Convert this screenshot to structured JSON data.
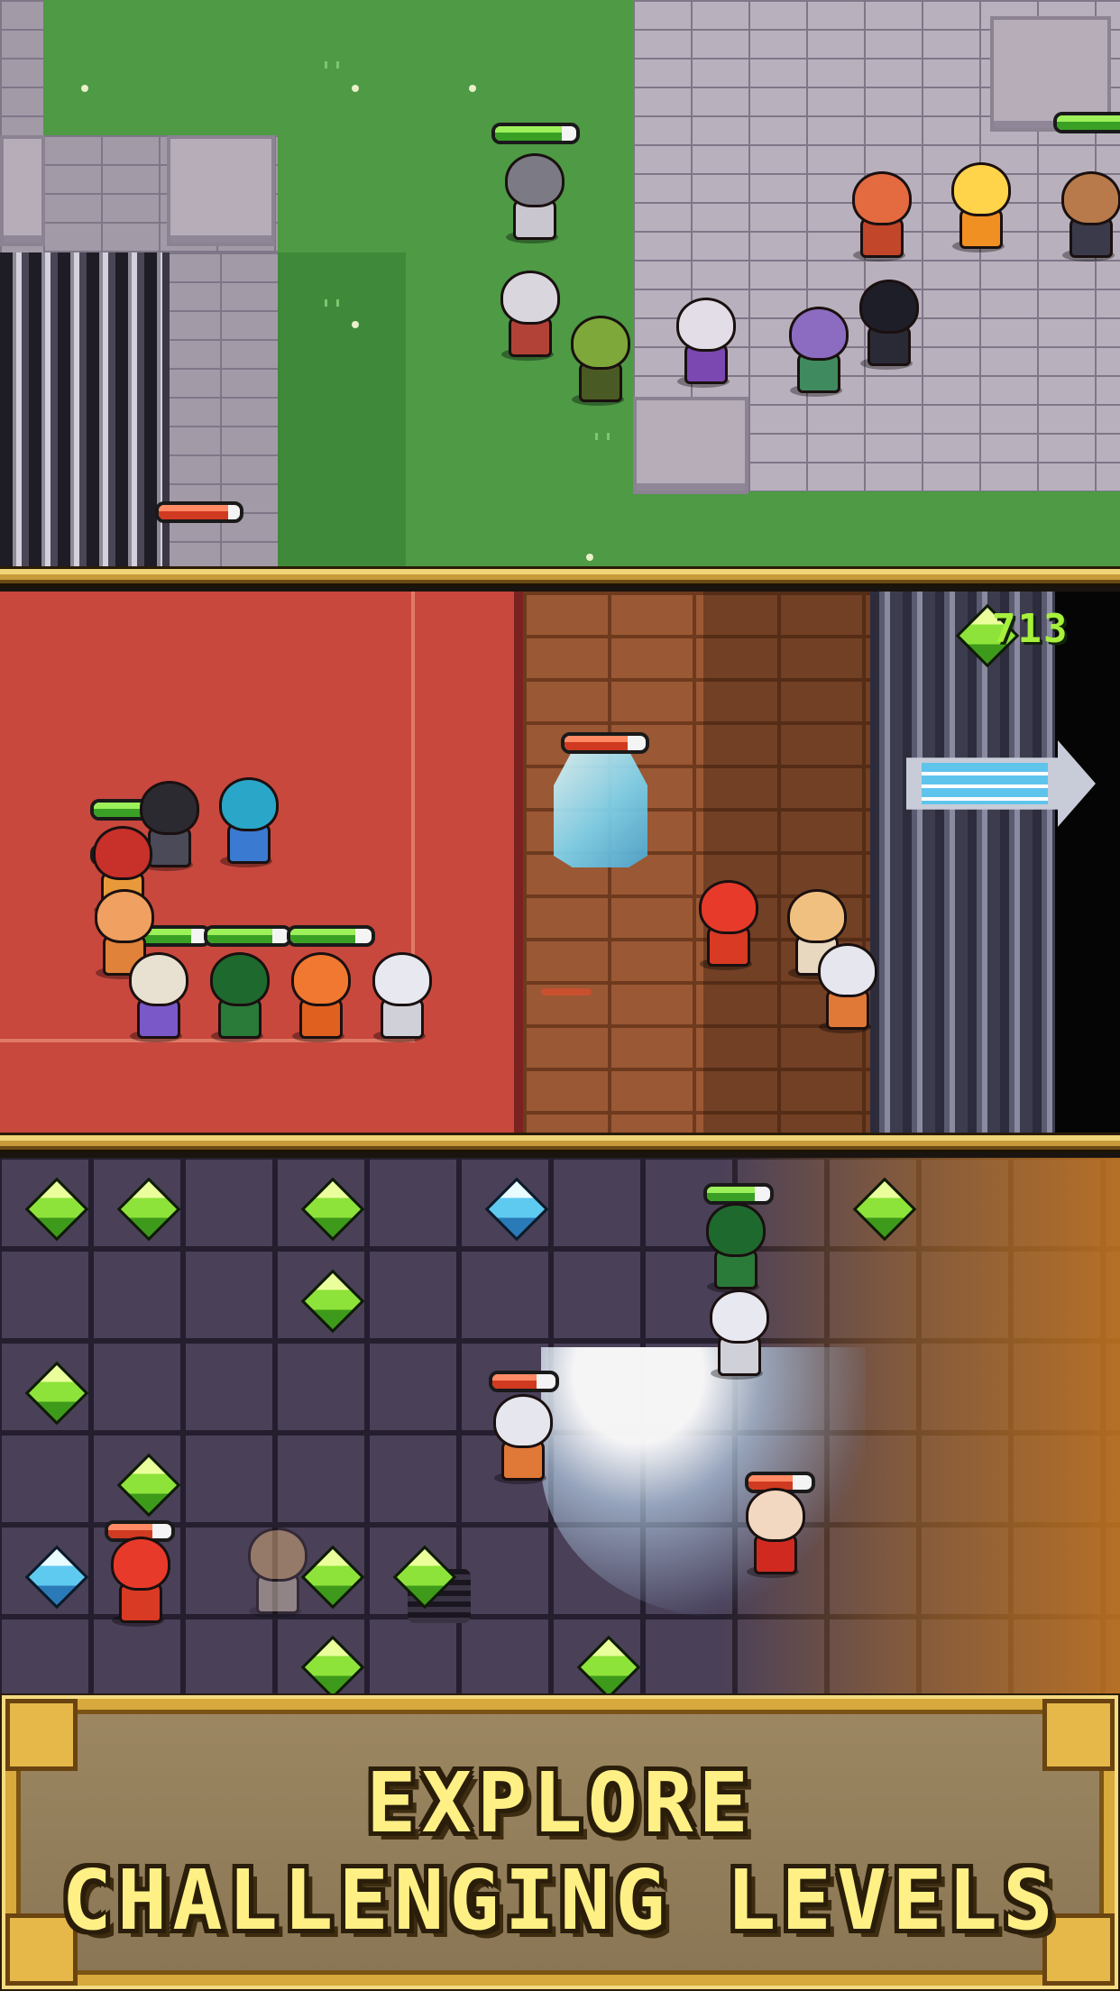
{
  "screen": "promo-screenshot",
  "colors": {
    "banner_text": "#fff086",
    "banner_bg": "#9c8762",
    "gold_frame": "#d8a93c",
    "gem_counter": "#a7f03c",
    "hp_green": "#3aa025",
    "hp_red": "#d03a20"
  },
  "panels": [
    {
      "name": "grass-castle-scene"
    },
    {
      "name": "carpet-brick-scene"
    },
    {
      "name": "dungeon-tile-scene"
    }
  ],
  "hud": {
    "gem_count": "713",
    "gem_icon": "green-gem-icon"
  },
  "banner": {
    "line1": "EXPLORE",
    "line2": "CHALLENGING LEVELS"
  }
}
